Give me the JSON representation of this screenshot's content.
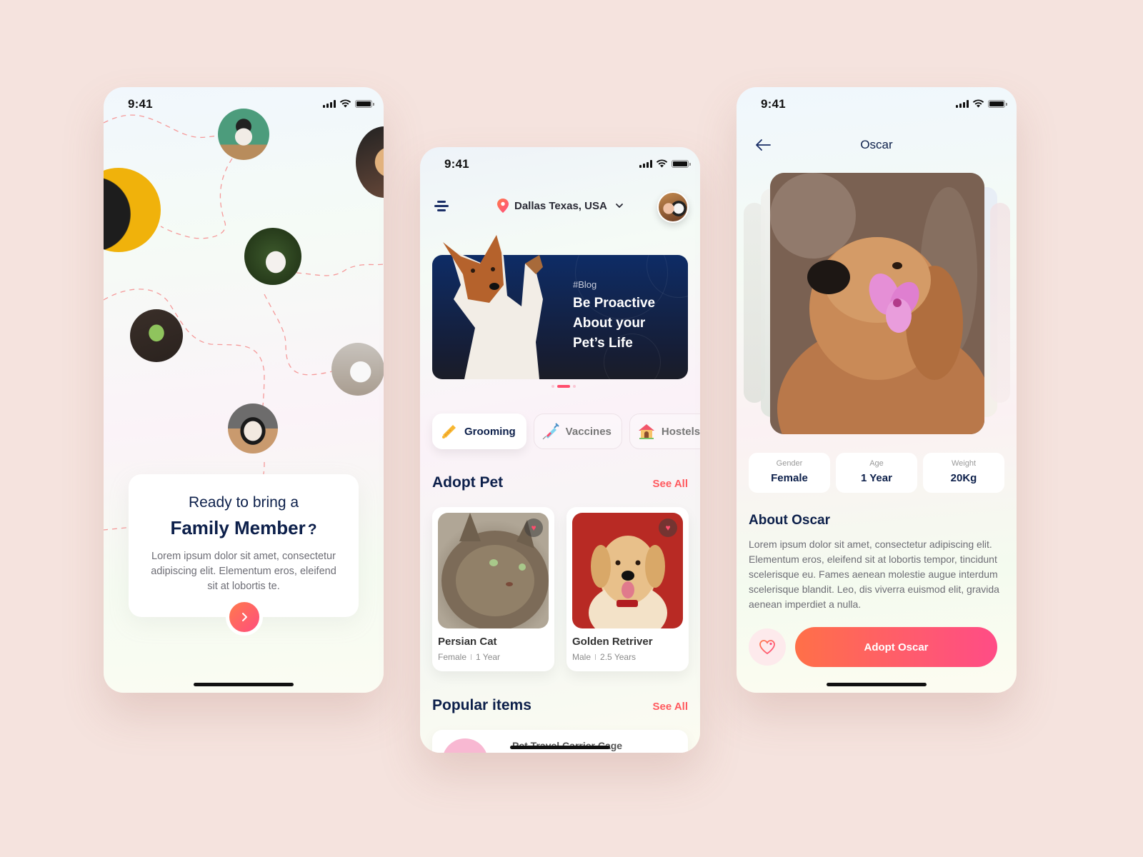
{
  "background_color": "#f5e3de",
  "accent_gradient": [
    "#ff7048",
    "#ff4c86"
  ],
  "status_bar": {
    "time": "9:41"
  },
  "onboarding": {
    "heading_line1": "Ready to bring a",
    "heading_line2": "Family Member",
    "heading_mark": "?",
    "body": "Lorem ipsum dolor sit amet, consectetur adipiscing elit. Elementum eros, eleifend sit at lobortis te.",
    "next_icon": "chevron-right-icon",
    "pets": [
      "cat",
      "pug",
      "dog",
      "rabbit",
      "parrot",
      "white-cat",
      "guinea-pig"
    ]
  },
  "home": {
    "location": "Dallas Texas, USA",
    "banner": {
      "tag": "#Blog",
      "title": "Be Proactive About your Pet’s Life",
      "slides": 3,
      "active_slide": 2
    },
    "categories": [
      {
        "label": "Grooming",
        "icon": "comb-icon",
        "active": true
      },
      {
        "label": "Vaccines",
        "icon": "syringe-icon",
        "active": false
      },
      {
        "label": "Hostels",
        "icon": "pet-house-icon",
        "active": false
      }
    ],
    "adopt_section": {
      "title": "Adopt Pet",
      "see_all": "See All"
    },
    "pets": [
      {
        "name": "Persian Cat",
        "gender": "Female",
        "age": "1 Year",
        "favorite": true
      },
      {
        "name": "Golden Retriver",
        "gender": "Male",
        "age": "2.5 Years",
        "favorite": true
      }
    ],
    "popular_section": {
      "title": "Popular items",
      "see_all": "See All"
    },
    "popular_items": [
      {
        "name": "Pet Travel Carrier Cage"
      }
    ]
  },
  "detail": {
    "title": "Oscar",
    "stats": [
      {
        "label": "Gender",
        "value": "Female"
      },
      {
        "label": "Age",
        "value": "1 Year"
      },
      {
        "label": "Weight",
        "value": "20Kg"
      }
    ],
    "about_title": "About Oscar",
    "about_body": "Lorem ipsum dolor sit amet, consectetur adipiscing elit. Elementum eros, eleifend sit at lobortis tempor, tincidunt scelerisque eu. Fames aenean molestie augue interdum scelerisque blandit. Leo, dis viverra euismod elit, gravida aenean imperdiet a nulla.",
    "adopt_button": "Adopt Oscar"
  }
}
